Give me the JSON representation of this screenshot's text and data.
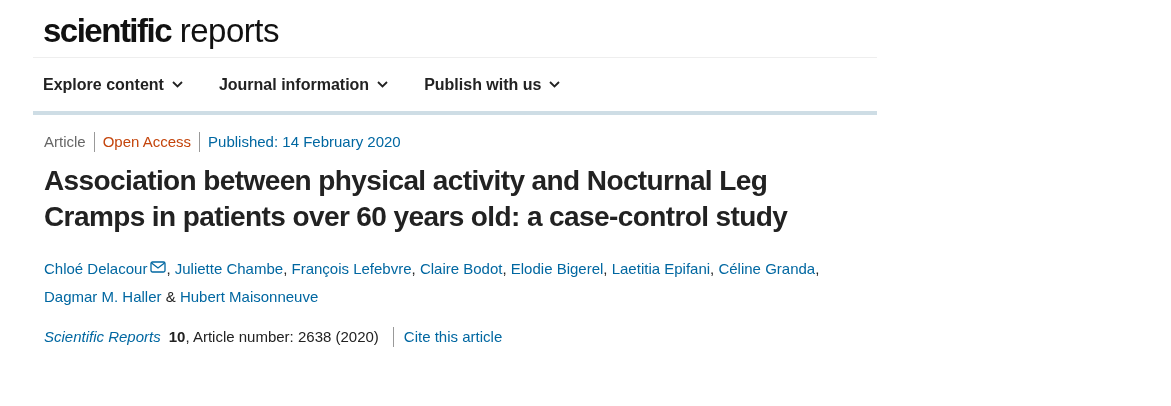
{
  "logo": {
    "bold": "scientific",
    "light": "reports"
  },
  "nav": [
    {
      "label": "Explore content",
      "expanded": false
    },
    {
      "label": "Journal information",
      "expanded": false
    },
    {
      "label": "Publish with us",
      "expanded": false
    }
  ],
  "meta": [
    {
      "kind": "type",
      "text": "Article"
    },
    {
      "kind": "access",
      "text": "Open Access"
    },
    {
      "kind": "date",
      "text": "Published: 14 February 2020"
    }
  ],
  "title": "Association between physical activity and Nocturnal Leg Cramps in patients over 60 years old: a case-control study",
  "authors": [
    {
      "name": "Chloé Delacour",
      "email": true,
      "separator": ","
    },
    {
      "name": "Juliette Chambe",
      "email": false,
      "separator": ","
    },
    {
      "name": "François Lefebvre",
      "email": false,
      "separator": ","
    },
    {
      "name": "Claire Bodot",
      "email": false,
      "separator": ","
    },
    {
      "name": "Elodie Bigerel",
      "email": false,
      "separator": ","
    },
    {
      "name": "Laetitia Epifani",
      "email": false,
      "separator": ","
    },
    {
      "name": "Céline Granda",
      "email": false,
      "separator": ","
    },
    {
      "name": "Dagmar M. Haller",
      "email": false,
      "separator": "&"
    },
    {
      "name": "Hubert Maisonneuve",
      "email": false
    }
  ],
  "citation": {
    "journal": "Scientific Reports",
    "volume": "10",
    "details": ", Article number: 2638 (2020)",
    "cite_link": "Cite this article"
  }
}
